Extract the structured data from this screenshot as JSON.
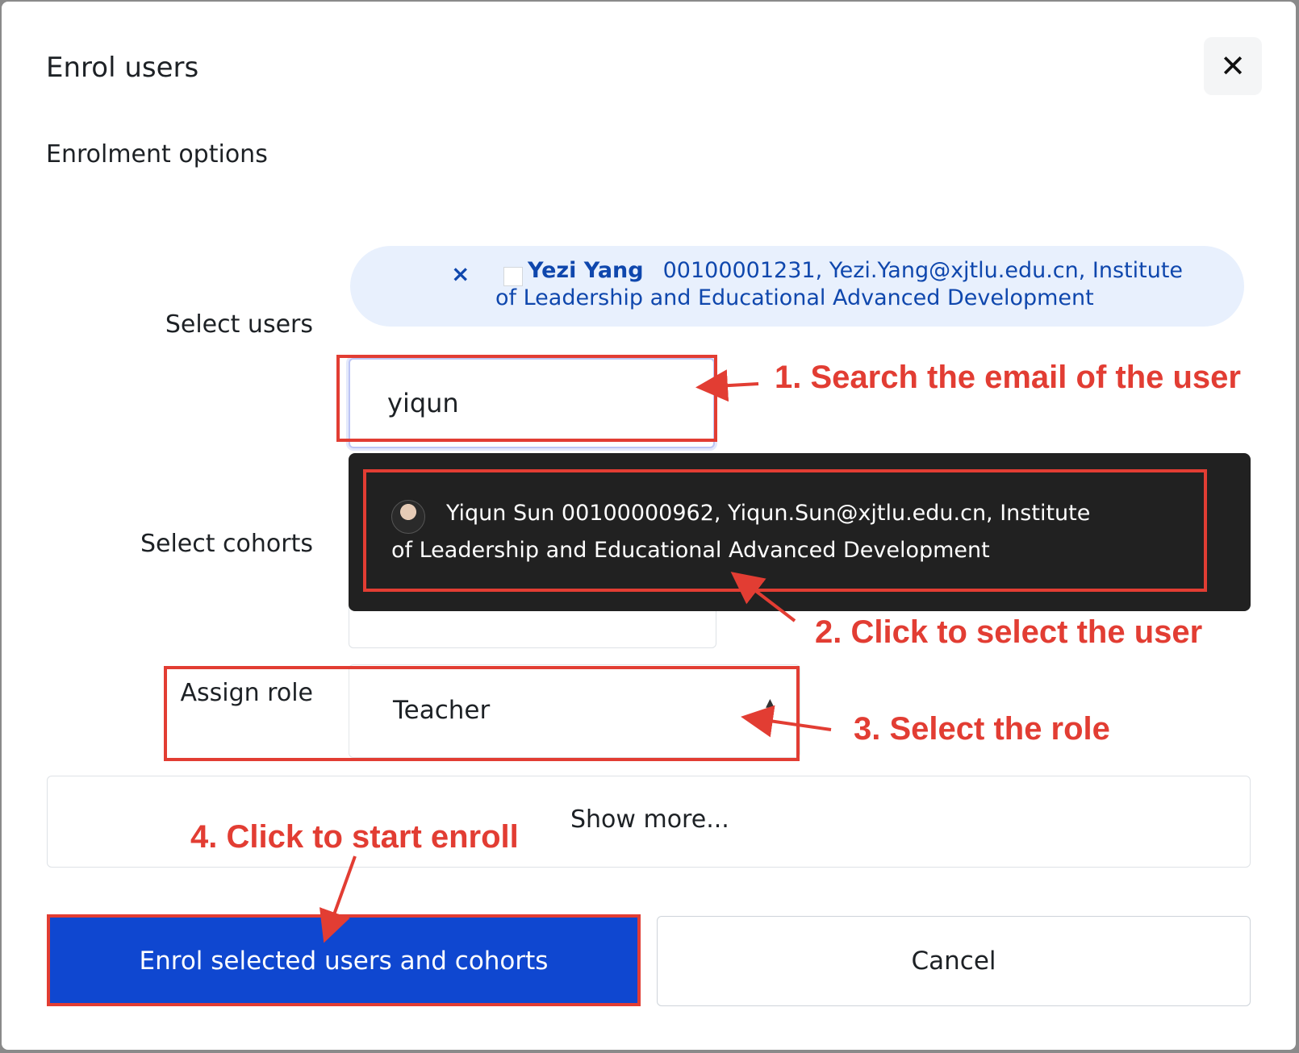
{
  "dialog": {
    "title": "Enrol users",
    "close_icon": "close-icon",
    "section_heading": "Enrolment options"
  },
  "select_users": {
    "label": "Select users",
    "selected_chip": {
      "remove_icon": "×",
      "name": "Yezi Yang",
      "details": "00100001231, Yezi.Yang@xjtlu.edu.cn, Institute of Leadership and Educational Advanced Development"
    },
    "search_value": "yiqun",
    "suggestion": {
      "text": "Yiqun Sun 00100000962, Yiqun.Sun@xjtlu.edu.cn, Institute of Leadership and Educational Advanced Development"
    }
  },
  "select_cohorts": {
    "label": "Select cohorts",
    "value": ""
  },
  "assign_role": {
    "label": "Assign role",
    "selected": "Teacher",
    "arrow_up": "▲",
    "arrow_down": "▼"
  },
  "show_more": "Show more...",
  "buttons": {
    "enrol": "Enrol selected users and cohorts",
    "cancel": "Cancel"
  },
  "annotations": {
    "step1": "1. Search the email of the user",
    "step2": "2. Click to select the user",
    "step3": "3. Select the role",
    "step4": "4. Click to start enroll"
  },
  "colors": {
    "annotation": "#e23d33",
    "primary": "#0f47d0",
    "link": "#0f47ad",
    "dropdown_bg": "#212121"
  }
}
